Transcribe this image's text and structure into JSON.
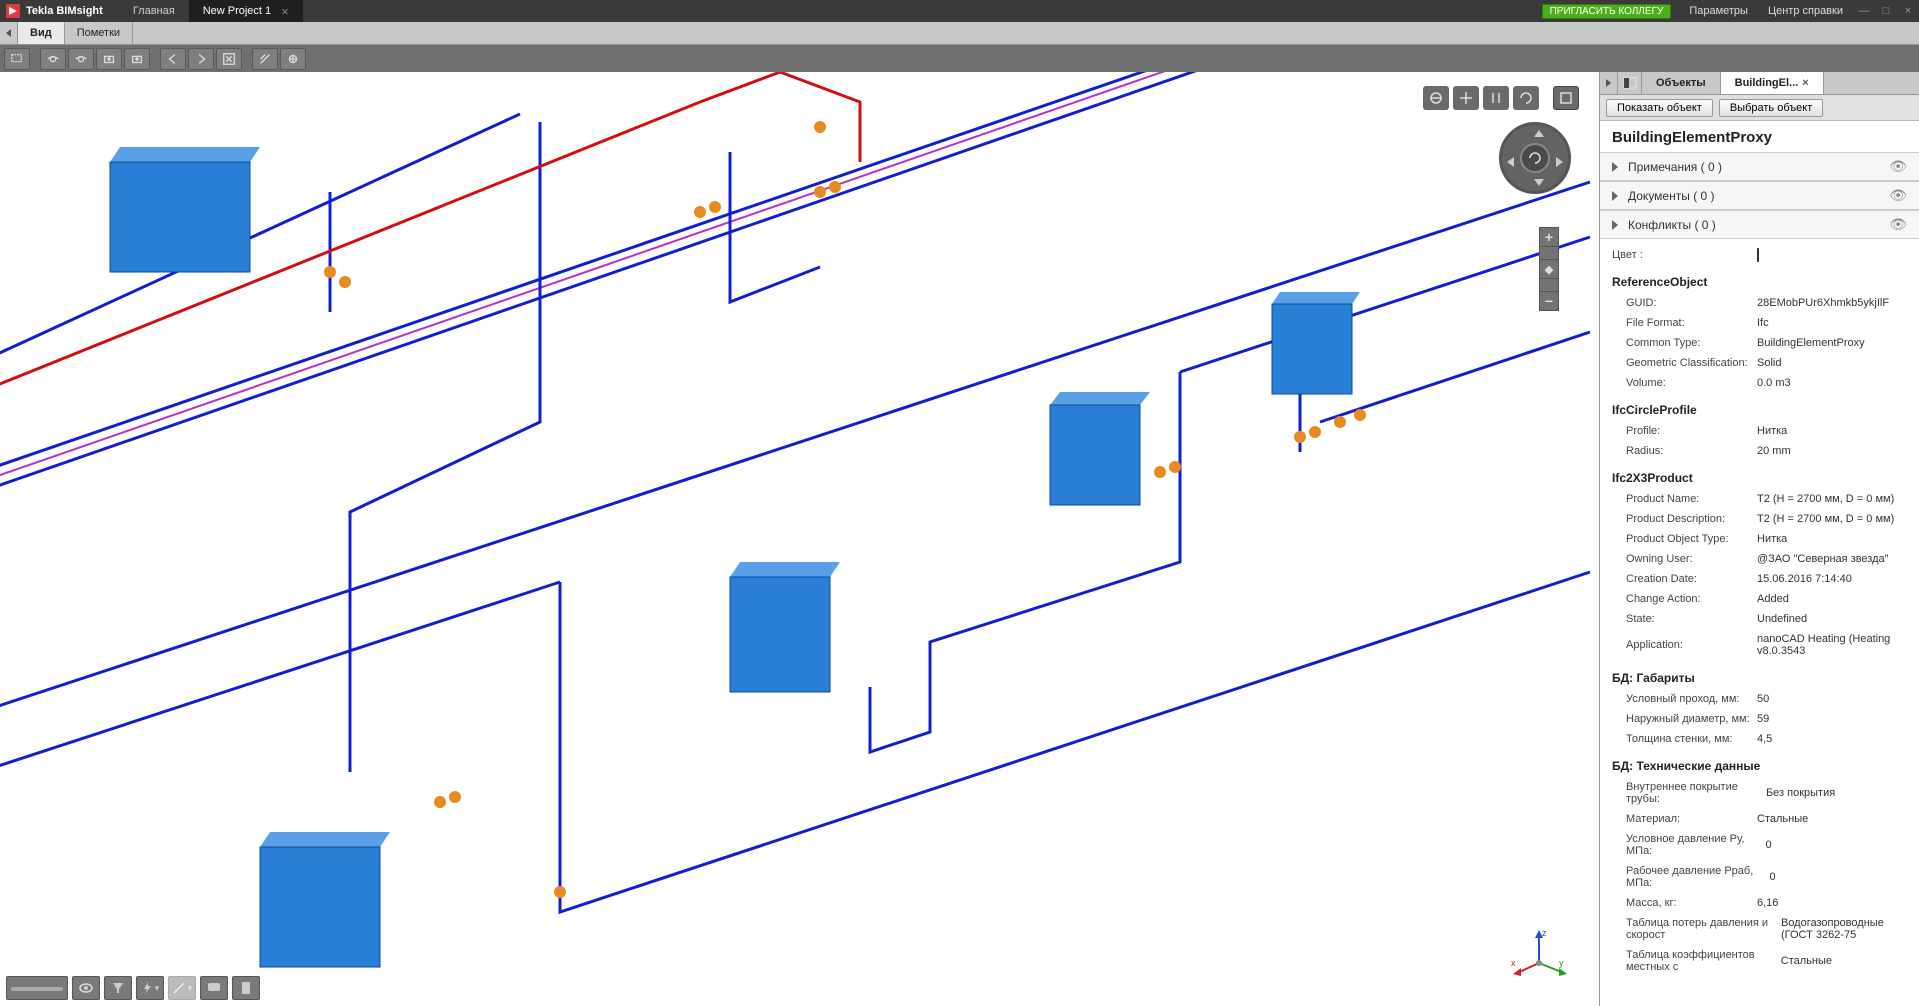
{
  "app": {
    "name": "Tekla BIMsight"
  },
  "top_tabs": {
    "home": "Главная",
    "project": "New Project 1"
  },
  "top_menu": {
    "invite": "ПРИГЛАСИТЬ КОЛЛЕГУ",
    "params": "Параметры",
    "help": "Центр справки"
  },
  "menubar": {
    "view": "Вид",
    "markup": "Пометки"
  },
  "right": {
    "tabs": {
      "objects": "Объекты",
      "elem": "BuildingEl..."
    },
    "actions": {
      "show": "Показать объект",
      "select": "Выбрать объект"
    },
    "title": "BuildingElementProxy",
    "acc": {
      "notes": "Примечания ( 0 )",
      "docs": "Документы ( 0 )",
      "conflicts": "Конфликты ( 0 )"
    },
    "color_label": "Цвет :",
    "sections": {
      "ref": "ReferenceObject",
      "circle": "IfcCircleProfile",
      "prod": "Ifc2X3Product",
      "dims": "БД: Габариты",
      "tech": "БД: Технические данные"
    },
    "props": {
      "guid_l": "GUID:",
      "guid_v": "28EMobPUr6Xhmkb5ykjIlF",
      "ff_l": "File Format:",
      "ff_v": "Ifc",
      "ct_l": "Common Type:",
      "ct_v": "BuildingElementProxy",
      "gc_l": "Geometric Classification:",
      "gc_v": "Solid",
      "vol_l": "Volume:",
      "vol_v": "0.0 m3",
      "prof_l": "Profile:",
      "prof_v": "Нитка",
      "rad_l": "Radius:",
      "rad_v": "20 mm",
      "pn_l": "Product Name:",
      "pn_v": "T2 (H = 2700 мм, D = 0 мм)",
      "pd_l": "Product Description:",
      "pd_v": "T2 (H = 2700 мм, D = 0 мм)",
      "pot_l": "Product Object Type:",
      "pot_v": "Нитка",
      "ou_l": "Owning User:",
      "ou_v": "@ЗАО \"Северная звезда\"",
      "cd_l": "Creation Date:",
      "cd_v": "15.06.2016 7:14:40",
      "ca_l": "Change Action:",
      "ca_v": "Added",
      "st_l": "State:",
      "st_v": "Undefined",
      "app_l": "Application:",
      "app_v": "nanoCAD Heating (Heating v8.0.3543",
      "up_l": "Условный проход, мм:",
      "up_v": "50",
      "nd_l": "Наружный диаметр, мм:",
      "nd_v": "59",
      "ts_l": "Толщина стенки, мм:",
      "ts_v": "4,5",
      "vp_l": "Внутреннее покрытие трубы:",
      "vp_v": "Без покрытия",
      "mat_l": "Материал:",
      "mat_v": "Стальные",
      "udp_l": "Условное давление Ру, МПа:",
      "udp_v": "0",
      "rdp_l": "Рабочее давление Рраб, МПа:",
      "rdp_v": "0",
      "mass_l": "Масса, кг:",
      "mass_v": "6,16",
      "tpd_l": "Таблица потерь давления и скорост",
      "tpd_v": "Водогазопроводные (ГОСТ 3262-75",
      "tkm_l": "Таблица коэффициентов местных с",
      "tkm_v": "Стальные"
    }
  }
}
